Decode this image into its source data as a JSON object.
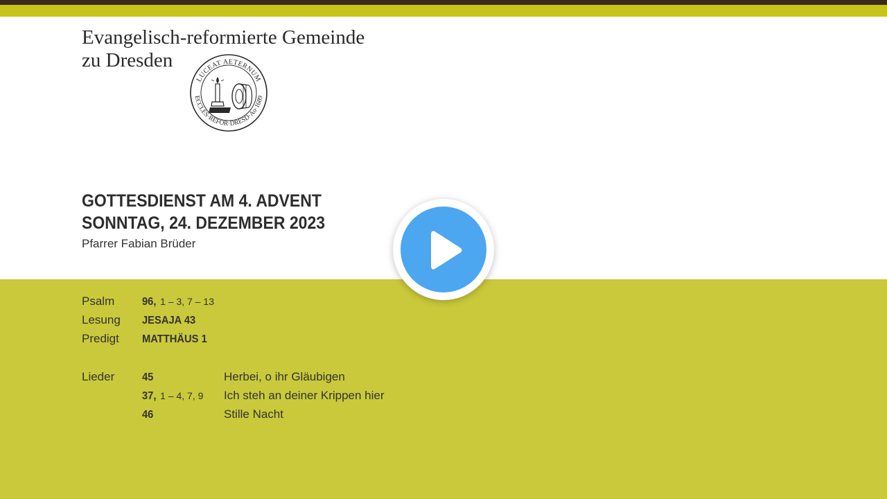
{
  "header": {
    "org_line1": "Evangelisch-reformierte Gemeinde",
    "org_line2": "zu Dresden",
    "seal": {
      "top_text": "LUCEAT AETERNUM",
      "bottom_text": "ECCLES·REFOR·DRESD·Ao·1689"
    }
  },
  "service": {
    "title_line1": "GOTTESDIENST AM 4. ADVENT",
    "title_line2": "SONNTAG, 24. DEZEMBER 2023",
    "pastor": "Pfarrer Fabian Brüder"
  },
  "readings": [
    {
      "label": "Psalm",
      "ref_bold": "96,",
      "ref_small": " 1 – 3, 7 – 13"
    },
    {
      "label": "Lesung",
      "ref_bold": "JESAJA 43",
      "ref_small": ""
    },
    {
      "label": "Predigt",
      "ref_bold": "MATTHÄUS 1",
      "ref_small": ""
    }
  ],
  "songs": {
    "label": "Lieder",
    "items": [
      {
        "number": "45",
        "verses": "",
        "title": "Herbei, o ihr Gläubigen"
      },
      {
        "number": "37,",
        "verses": " 1 – 4, 7, 9",
        "title": "Ich steh an deiner Krippen hier"
      },
      {
        "number": "46",
        "verses": "",
        "title": "Stille Nacht"
      }
    ]
  },
  "player": {
    "icon": "play-icon",
    "accent": "#4ca6f0"
  },
  "colors": {
    "stripe_dark": "#3c2b1a",
    "stripe_lime": "#c6c418",
    "panel": "#cac93b"
  }
}
